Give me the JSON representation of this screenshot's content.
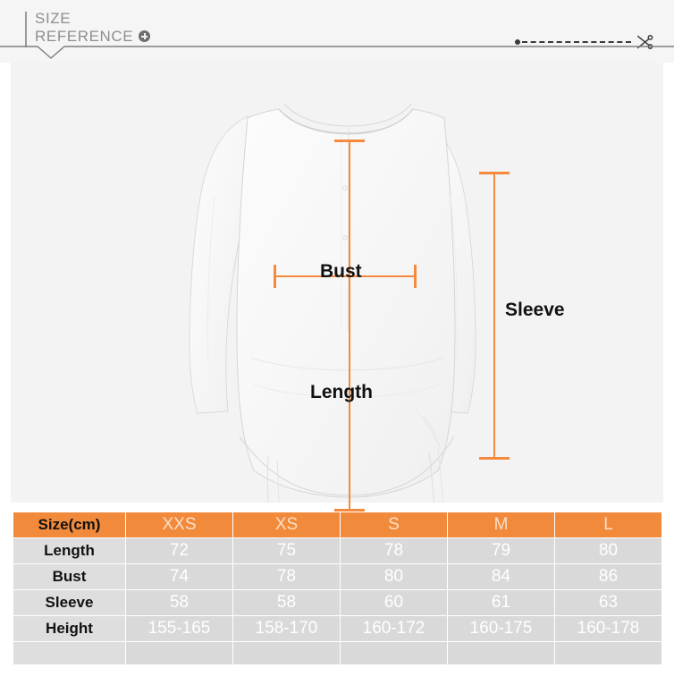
{
  "header": {
    "title_line1": "SIZE",
    "title_line2": "REFERENCE",
    "expand_icon": "plus-circle-icon",
    "cut_icon": "scissors-icon"
  },
  "garment": {
    "image_name": "long-sleeve-shirt-illustration",
    "measurements": [
      {
        "id": "bust",
        "label": "Bust",
        "orientation": "horizontal",
        "color": "#F58A3E"
      },
      {
        "id": "length",
        "label": "Length",
        "orientation": "vertical",
        "color": "#F58A3E"
      },
      {
        "id": "sleeve",
        "label": "Sleeve",
        "orientation": "vertical",
        "color": "#F58A3E"
      }
    ]
  },
  "colors": {
    "accent_orange": "#F28A3C",
    "measure_orange": "#F58A3E",
    "panel_gray": "#f3f3f3",
    "cell_gray": "#d9d9d9",
    "label_gray": "#dedede"
  },
  "chart_data": {
    "type": "table",
    "title": "Size(cm)",
    "categories": [
      "XXS",
      "XS",
      "S",
      "M",
      "L"
    ],
    "rows": [
      {
        "name": "Length",
        "values": [
          "72",
          "75",
          "78",
          "79",
          "80"
        ]
      },
      {
        "name": "Bust",
        "values": [
          "74",
          "78",
          "80",
          "84",
          "86"
        ]
      },
      {
        "name": "Sleeve",
        "values": [
          "58",
          "58",
          "60",
          "61",
          "63"
        ]
      },
      {
        "name": "Height",
        "values": [
          "155-165",
          "158-170",
          "160-172",
          "160-175",
          "160-178"
        ]
      }
    ],
    "empty_row": {
      "name": "",
      "values": [
        "",
        "",
        "",
        "",
        ""
      ]
    }
  }
}
